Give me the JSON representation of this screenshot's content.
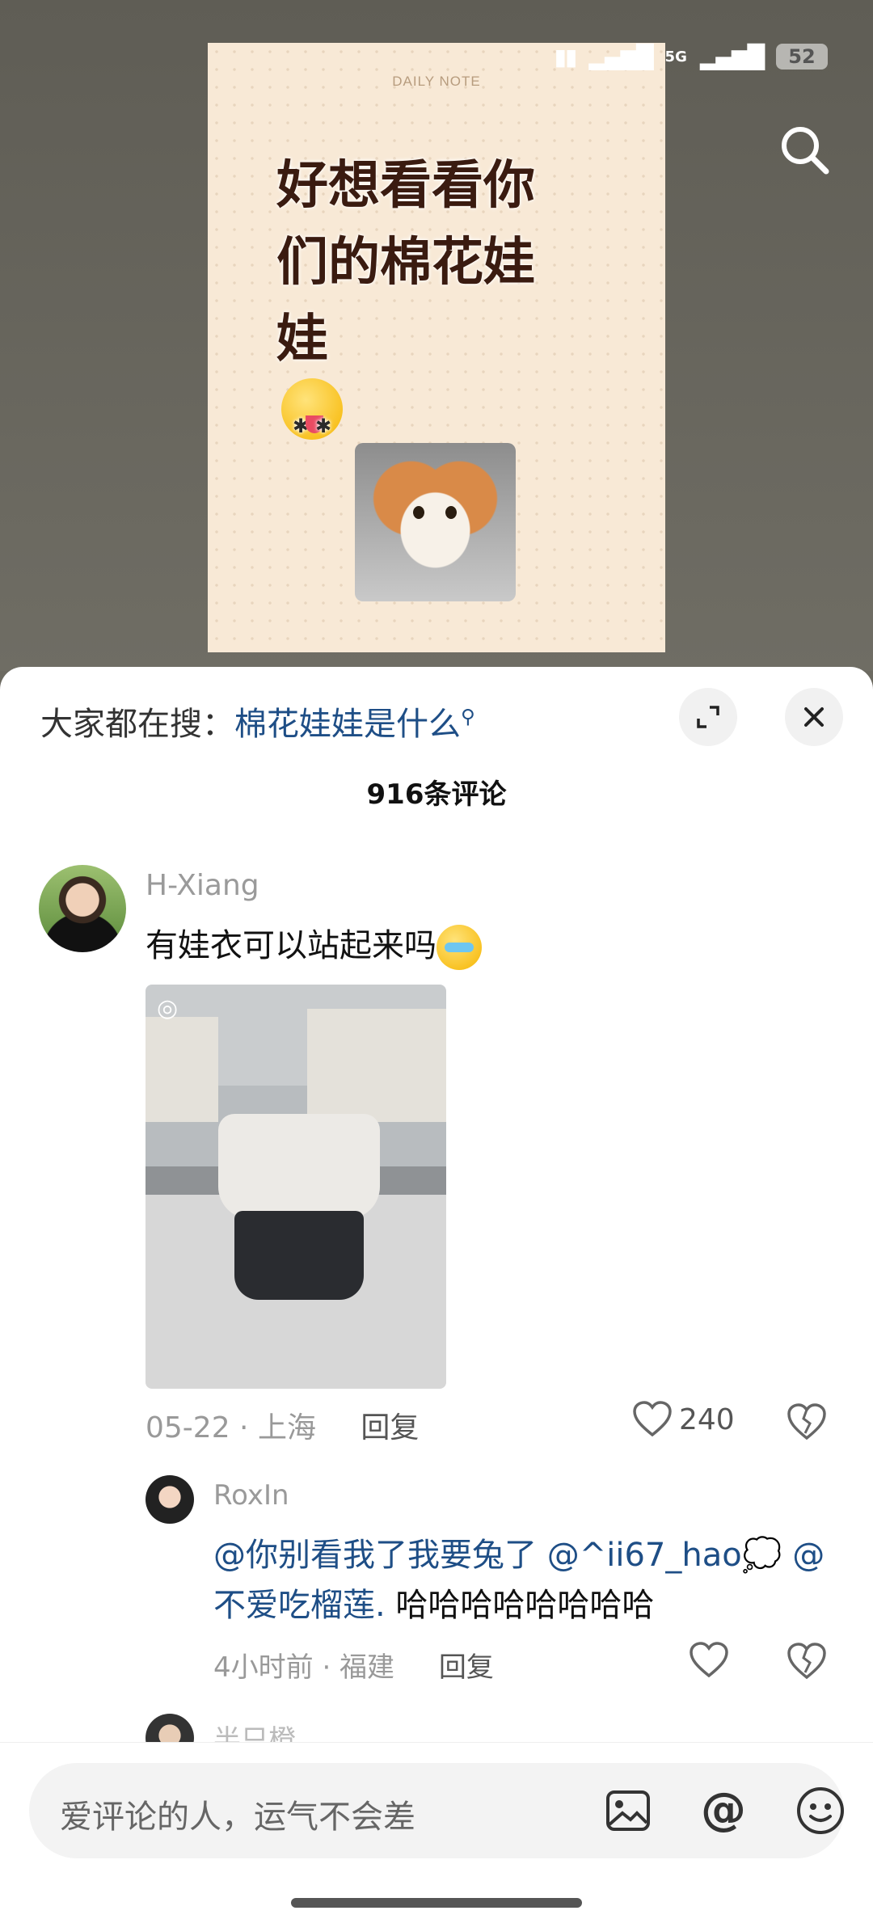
{
  "status": {
    "network": "5G",
    "battery": "52"
  },
  "note": {
    "label": "DAILY NOTE",
    "title_lines": [
      "好想看看你",
      "们的棉花娃",
      "娃"
    ]
  },
  "sheet": {
    "search_prefix": "大家都在搜：",
    "search_hot": "棉花娃娃是什么",
    "comment_count": "916条评论"
  },
  "comments": [
    {
      "user": "H-Xiang",
      "text": "有娃衣可以站起来吗",
      "meta": "05-22 · 上海",
      "reply": "回复",
      "likes": "240"
    },
    {
      "user": "RoxIn",
      "mention1": "@你别看我了我要兔了",
      "mention2": "@^ii67_hao",
      "mention3": "@不爱吃榴莲.",
      "text": " 哈哈哈哈哈哈哈哈",
      "meta": "4小时前 · 福建",
      "reply": "回复"
    },
    {
      "user": "半只橙"
    }
  ],
  "input": {
    "placeholder": "爱评论的人，运气不会差"
  }
}
